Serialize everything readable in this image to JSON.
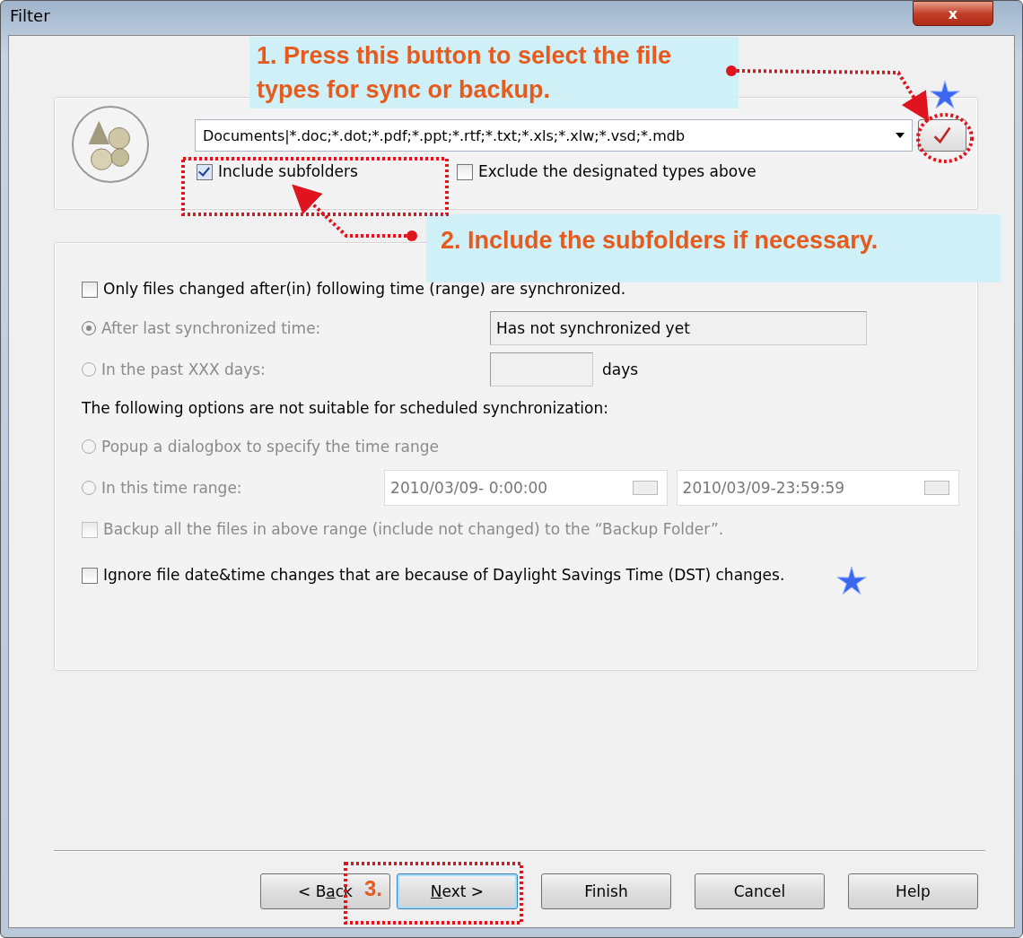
{
  "window": {
    "title": "Filter",
    "close_label": "x"
  },
  "file_types": {
    "value": "Documents|*.doc;*.dot;*.pdf;*.ppt;*.rtf;*.txt;*.xls;*.xlw;*.vsd;*.mdb",
    "options": [
      {
        "label": "Include subfolders",
        "checked": true
      },
      {
        "label": "Exclude the designated types above",
        "checked": false
      }
    ]
  },
  "date_filter": {
    "rows": [
      {
        "kind": "checkbox",
        "label": "Only files changed after(in) following time (range) are synchronized.",
        "checked": false,
        "disabled": false
      },
      {
        "kind": "radio",
        "label": "After last synchronized time:",
        "selected": true,
        "disabled": true,
        "field": {
          "value": "Has not synchronized yet"
        }
      },
      {
        "kind": "radio",
        "label": "In the past XXX days:",
        "selected": false,
        "disabled": true,
        "empty_field": true,
        "unit": "days"
      },
      {
        "kind": "note",
        "label": "The following options are not suitable for scheduled synchronization:"
      },
      {
        "kind": "radio",
        "label": "Popup a dialogbox to specify the time range",
        "selected": false,
        "disabled": true
      },
      {
        "kind": "radio",
        "label": "In this time range:",
        "selected": false,
        "disabled": true,
        "range": [
          "2010/03/09-  0:00:00",
          "2010/03/09-23:59:59"
        ]
      },
      {
        "kind": "checkbox",
        "label": "Backup all the files in above range (include not changed) to the “Backup Folder”.",
        "checked": false,
        "disabled": true
      },
      {
        "kind": "checkbox",
        "label": "Ignore file date&time changes that are because of Daylight Savings Time (DST) changes.",
        "checked": false,
        "disabled": false,
        "star": true
      }
    ]
  },
  "buttons": [
    {
      "label_start": "< B",
      "mnemonic": "a",
      "label_end": "ck",
      "focused": false
    },
    {
      "mnemonic": "N",
      "label_end": "ext >",
      "focused": true
    },
    {
      "label": "Finish",
      "focused": false
    },
    {
      "label": "Cancel",
      "focused": false
    },
    {
      "label": "Help",
      "focused": false
    }
  ],
  "annotations": [
    {
      "kind": "callout",
      "text": "1. Press this button to select the file types for sync or backup."
    },
    {
      "kind": "callout",
      "text": "2. Include the subfolders if necessary."
    },
    {
      "kind": "step",
      "text": "3."
    }
  ]
}
